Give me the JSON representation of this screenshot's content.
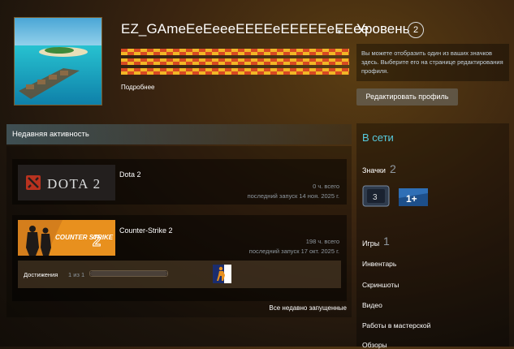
{
  "profile": {
    "username": "EZ_GAmeEeEeeeEEEEeEEEEEeEEee",
    "more_link": "Подробнее",
    "avatar_alt": ""
  },
  "level": {
    "label": "Уровень",
    "value": "2"
  },
  "badge_hint": "Вы можете отобразить один из ваших значков здесь. Выберите его на странице редактирования профиля.",
  "edit_profile_button": "Редактировать профиль",
  "recent_activity": {
    "title": "Недавняя активность",
    "games": [
      {
        "name": "Dota 2",
        "capsule_text": "DOTA 2",
        "playtime": "0 ч. всего",
        "last_played": "последний запуск 14 ноя. 2025 г."
      },
      {
        "name": "Counter-Strike 2",
        "capsule_text": "COUNTER STRIKE",
        "playtime": "198 ч. всего",
        "last_played": "последний запуск 17 окт. 2025 г.",
        "achievements_label": "Достижения",
        "achievements_count": "1 из 1",
        "achievements_progress": 1.0
      }
    ],
    "all_recent_link": "Все недавно запущенные"
  },
  "sidebar": {
    "status": "В сети",
    "badges_label": "Значки",
    "badges_count": "2",
    "badge_items": [
      "3",
      "1+"
    ],
    "games_label": "Игры",
    "games_count": "1",
    "links": [
      "Инвентарь",
      "Скриншоты",
      "Видео",
      "Работы в мастерской",
      "Обзоры"
    ]
  },
  "colors": {
    "online": "#57cbde",
    "accent_button": "#676256",
    "flair_red": "#c83a20",
    "flair_yellow": "#f0b020"
  }
}
